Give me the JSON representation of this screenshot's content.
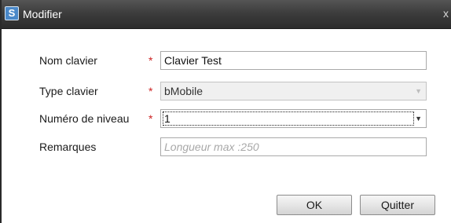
{
  "window": {
    "title": "Modifier",
    "app_icon_glyph": "S",
    "close_glyph": "x"
  },
  "form": {
    "nom_clavier": {
      "label": "Nom clavier",
      "required_mark": "*",
      "value": "Clavier Test"
    },
    "type_clavier": {
      "label": "Type clavier",
      "required_mark": "*",
      "value": "bMobile",
      "disabled": true
    },
    "numero_niveau": {
      "label": "Numéro de niveau",
      "required_mark": "*",
      "value": "1"
    },
    "remarques": {
      "label": "Remarques",
      "value": "",
      "placeholder": "Longueur max :250"
    }
  },
  "buttons": {
    "ok_label": "OK",
    "quit_label": "Quitter"
  },
  "colors": {
    "titlebar": "#3d3d3d",
    "required": "#cc2222",
    "app_icon": "#4a88c8"
  }
}
